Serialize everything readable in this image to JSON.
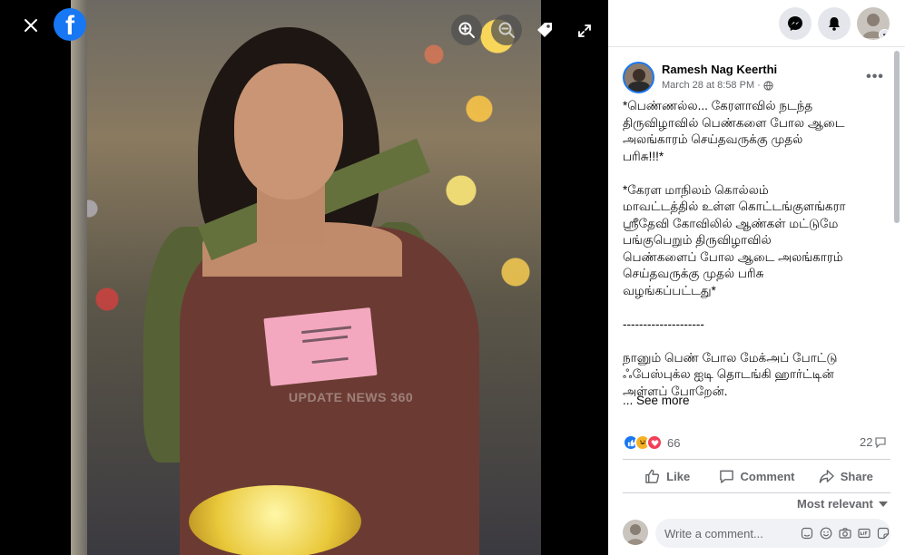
{
  "viewer": {
    "watermark": "UPDATE NEWS 360",
    "logo_letter": "f"
  },
  "post": {
    "author": "Ramesh Nag Keerthi",
    "timestamp": "March 28 at 8:58 PM",
    "separator": "·",
    "text_1": "*பெண்ணல்ல... கேரளாவில் நடந்த\nதிருவிழாவில் பெண்களை போல ஆடை\nஅலங்காரம் செய்தவருக்கு முதல்\nபரிசு!!!*",
    "text_2": "*கேரள மாநிலம் கொல்லம்\nமாவட்டத்தில் உள்ள கொட்டங்குளங்கரா\nஸ்ரீதேவி கோவிலில் ஆண்கள் மட்டுமே\nபங்குபெறும் திருவிழாவில்\nபெண்களைப் போல ஆடை அலங்காரம்\nசெய்தவருக்கு முதல் பரிசு\nவழங்கப்பட்டது*",
    "text_3": "--------------------",
    "text_4": "நானும் பெண் போல மேக்அப் போட்டு\nஃபேஸ்புக்ல ஐடி தொடங்கி ஹார்ட்டின்\nஅள்ளப் போறேன்.",
    "see_more": "... See more",
    "reaction_count": "66",
    "comment_count": "22"
  },
  "actions": {
    "like": "Like",
    "comment": "Comment",
    "share": "Share"
  },
  "comments": {
    "sort_label": "Most relevant",
    "placeholder": "Write a comment..."
  },
  "colors": {
    "brand": "#1877f2",
    "love": "#f33e58",
    "haha": "#f7b125"
  },
  "icons": {
    "close": "close-icon",
    "zoom_in": "zoom-in-icon",
    "zoom_out": "zoom-out-icon",
    "tag": "tag-icon",
    "fullscreen": "fullscreen-icon",
    "messenger": "messenger-icon",
    "notifications": "bell-icon",
    "privacy": "globe-icon"
  }
}
